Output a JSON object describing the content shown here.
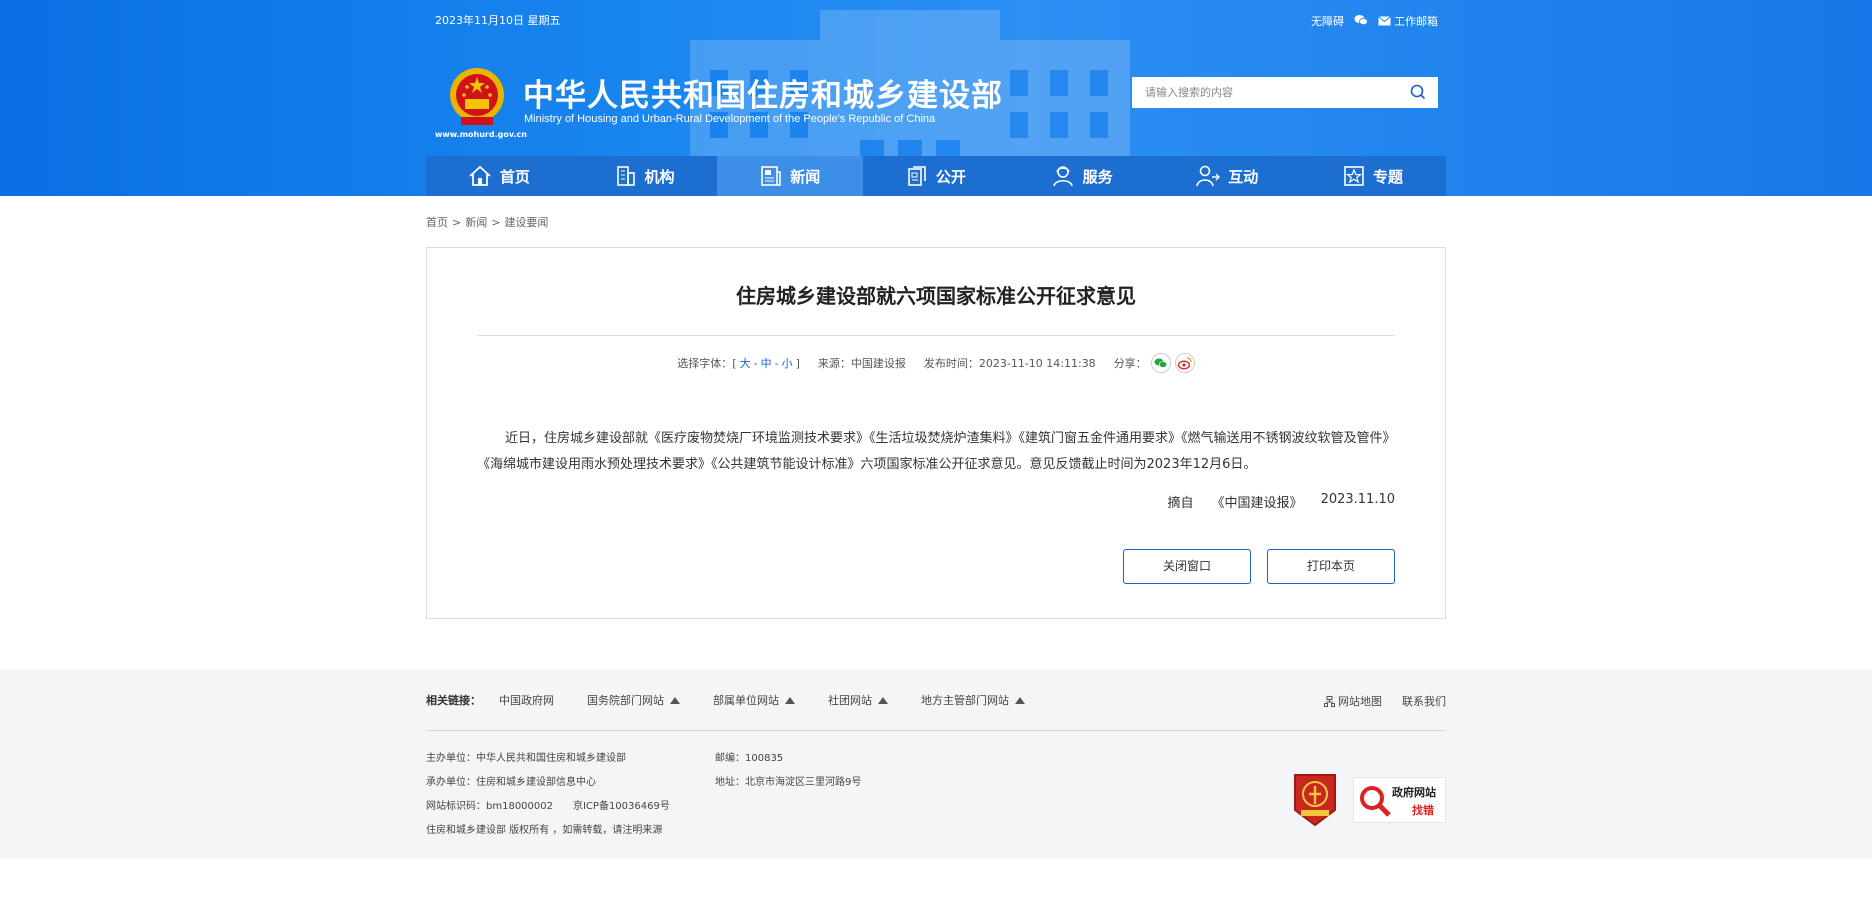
{
  "header": {
    "date": "2023年11月10日 星期五",
    "top_links": {
      "accessibility": "无障碍",
      "mail": "工作邮箱"
    },
    "title_cn": "中华人民共和国住房和城乡建设部",
    "title_en": "Ministry of Housing and Urban-Rural Development of the People's Republic of China",
    "site_url": "www.mohurd.gov.cn",
    "search_placeholder": "请输入搜索的内容"
  },
  "nav": {
    "items": [
      {
        "label": "首页",
        "icon": "home-icon"
      },
      {
        "label": "机构",
        "icon": "building-icon"
      },
      {
        "label": "新闻",
        "icon": "news-icon",
        "active": true
      },
      {
        "label": "公开",
        "icon": "document-icon"
      },
      {
        "label": "服务",
        "icon": "service-icon"
      },
      {
        "label": "互动",
        "icon": "interaction-icon"
      },
      {
        "label": "专题",
        "icon": "star-icon"
      }
    ]
  },
  "breadcrumb": {
    "items": [
      "首页",
      "新闻",
      "建设要闻"
    ],
    "sep": ">"
  },
  "article": {
    "title": "住房城乡建设部就六项国家标准公开征求意见",
    "font_label": "选择字体：",
    "font_open": "[",
    "font_large": "大",
    "font_mid": "中",
    "font_small": "小",
    "font_dash": "-",
    "font_close": "]",
    "source": "来源：中国建设报",
    "publish_time": "发布时间：2023-11-10 14:11:38",
    "share_label": "分享：",
    "body": "近日，住房城乡建设部就《医疗废物焚烧厂环境监测技术要求》《生活垃圾焚烧炉渣集料》《建筑门窗五金件通用要求》《燃气输送用不锈钢波纹软管及管件》《海绵城市建设用雨水预处理技术要求》《公共建筑节能设计标准》六项国家标准公开征求意见。意见反馈截止时间为2023年12月6日。",
    "excerpt_label": "摘自",
    "excerpt_source": "《中国建设报》",
    "excerpt_date": "2023.11.10",
    "close_button": "关闭窗口",
    "print_button": "打印本页"
  },
  "footer": {
    "links_label": "相关链接：",
    "links": [
      {
        "label": "中国政府网",
        "dropdown": false
      },
      {
        "label": "国务院部门网站",
        "dropdown": true
      },
      {
        "label": "部属单位网站",
        "dropdown": true
      },
      {
        "label": "社团网站",
        "dropdown": true
      },
      {
        "label": "地方主管部门网站",
        "dropdown": true
      }
    ],
    "sitemap": "网站地图",
    "contact": "联系我们",
    "info_col1": [
      "主办单位：中华人民共和国住房和城乡建设部",
      "承办单位：住房和城乡建设部信息中心",
      "网站标识码：bm18000002　　京ICP备10036469号",
      "住房和城乡建设部 版权所有 ，如需转载，请注明来源"
    ],
    "info_col2": [
      "邮编：100835",
      "地址：北京市海淀区三里河路9号"
    ],
    "badge2_line1": "政府网站",
    "badge2_line2": "找错"
  },
  "colors": {
    "header_blue": "#0a6fe3",
    "nav_blue": "#1c6fd1",
    "nav_active": "#3d8ee6",
    "link_blue": "#1a62c6"
  }
}
